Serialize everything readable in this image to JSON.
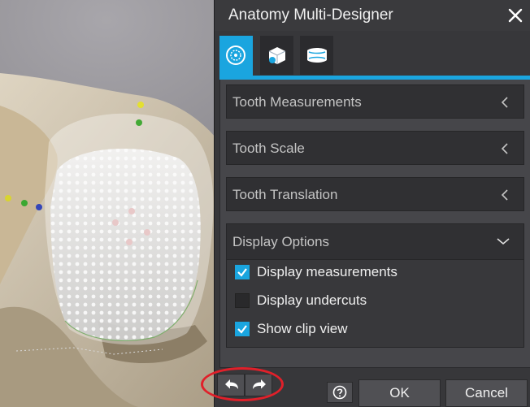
{
  "dialog": {
    "title": "Anatomy Multi-Designer",
    "close_icon": "close-icon"
  },
  "tabs": [
    {
      "icon": "tooth-target-icon",
      "active": true
    },
    {
      "icon": "tooth-box-icon",
      "active": false
    },
    {
      "icon": "dental-arch-icon",
      "active": false
    }
  ],
  "sections": [
    {
      "label": "Tooth Measurements",
      "state": "collapsed"
    },
    {
      "label": "Tooth Scale",
      "state": "collapsed"
    },
    {
      "label": "Tooth Translation",
      "state": "collapsed"
    },
    {
      "label": "Display Options",
      "state": "expanded"
    }
  ],
  "display_options": [
    {
      "label": "Display measurements",
      "checked": true
    },
    {
      "label": "Display undercuts",
      "checked": false
    },
    {
      "label": "Show clip view",
      "checked": true
    }
  ],
  "footer": {
    "undo_icon": "undo-icon",
    "redo_icon": "redo-icon",
    "help_icon": "help-icon",
    "ok_label": "OK",
    "cancel_label": "Cancel"
  },
  "colors": {
    "accent": "#1aa5df",
    "panel": "#37373a",
    "highlight": "#e0202a"
  }
}
